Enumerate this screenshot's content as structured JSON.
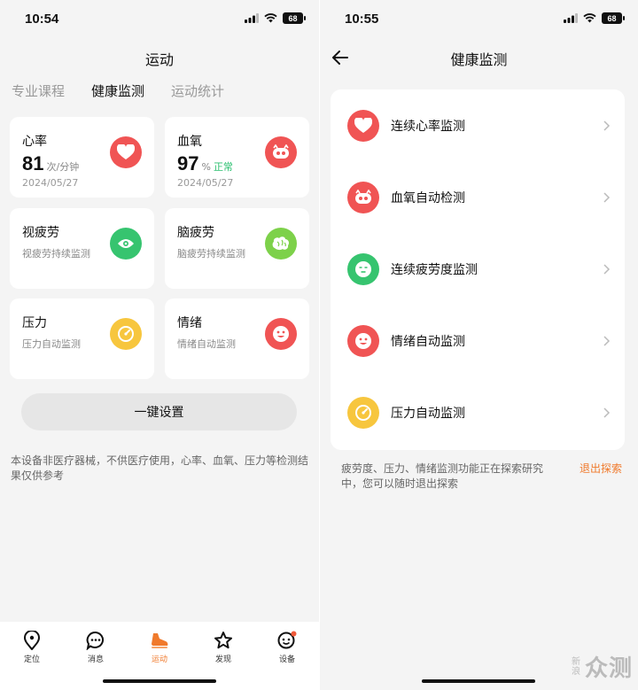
{
  "left": {
    "status": {
      "time": "10:54",
      "battery": "68"
    },
    "title": "运动",
    "tabs": [
      "专业课程",
      "健康监测",
      "运动统计"
    ],
    "cards": {
      "heart": {
        "title": "心率",
        "value": "81",
        "unit": "次/分钟",
        "date": "2024/05/27"
      },
      "spo2": {
        "title": "血氧",
        "value": "97",
        "unit": "%",
        "status": "正常",
        "date": "2024/05/27"
      },
      "eye": {
        "title": "视疲劳",
        "subtitle": "视疲劳持续监测"
      },
      "brain": {
        "title": "脑疲劳",
        "subtitle": "脑疲劳持续监测"
      },
      "stress": {
        "title": "压力",
        "subtitle": "压力自动监测"
      },
      "mood": {
        "title": "情绪",
        "subtitle": "情绪自动监测"
      }
    },
    "one_key_button": "一键设置",
    "disclaimer": "本设备非医疗器械，不供医疗使用，心率、血氧、压力等检测结果仅供参考",
    "tabbar": [
      "定位",
      "消息",
      "运动",
      "发现",
      "设备"
    ]
  },
  "right": {
    "status": {
      "time": "10:55",
      "battery": "68"
    },
    "title": "健康监测",
    "rows": [
      "连续心率监测",
      "血氧自动检测",
      "连续疲劳度监测",
      "情绪自动监测",
      "压力自动监测"
    ],
    "note": "疲劳度、压力、情绪监测功能正在探索研究中，您可以随时退出探索",
    "exit_label": "退出探索"
  },
  "watermark": {
    "small": "新浪",
    "big": "众测"
  },
  "colors": {
    "accent": "#f07a2c",
    "red": "#f05454",
    "green": "#36c46f",
    "lime": "#7dd14a",
    "yellow": "#f7c63e"
  }
}
